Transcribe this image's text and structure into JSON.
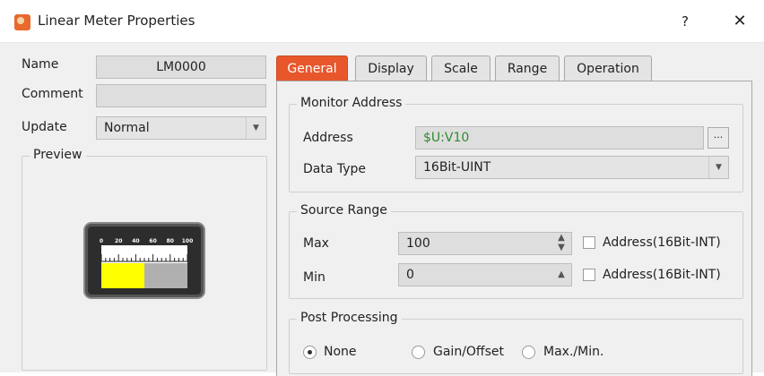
{
  "window": {
    "title": "Linear Meter Properties",
    "help_label": "?",
    "close_label": "✕"
  },
  "left": {
    "name_label": "Name",
    "name_value": "LM0000",
    "comment_label": "Comment",
    "comment_value": "",
    "update_label": "Update",
    "update_value": "Normal",
    "preview_label": "Preview",
    "meter": {
      "ticks": [
        "0",
        "20",
        "40",
        "60",
        "80",
        "100"
      ],
      "level": 0.5,
      "fill_color": "#ffff00",
      "empty_color": "#b0b0b0"
    }
  },
  "tabs": [
    {
      "label": "General",
      "active": true
    },
    {
      "label": "Display",
      "active": false
    },
    {
      "label": "Scale",
      "active": false
    },
    {
      "label": "Range",
      "active": false
    },
    {
      "label": "Operation",
      "active": false
    }
  ],
  "general": {
    "monitor_address": {
      "title": "Monitor Address",
      "address_label": "Address",
      "address_value": "$U:V10",
      "address_color": "#2e8b2e",
      "browse_label": "...",
      "data_type_label": "Data Type",
      "data_type_value": "16Bit-UINT"
    },
    "source_range": {
      "title": "Source Range",
      "max_label": "Max",
      "max_value": "100",
      "max_checkbox_label": "Address(16Bit-INT)",
      "min_label": "Min",
      "min_value": "0",
      "min_checkbox_label": "Address(16Bit-INT)"
    },
    "post_processing": {
      "title": "Post Processing",
      "options": [
        {
          "label": "None",
          "checked": true
        },
        {
          "label": "Gain/Offset",
          "checked": false
        },
        {
          "label": "Max./Min.",
          "checked": false
        }
      ]
    }
  },
  "accent_color": "#e8572b"
}
